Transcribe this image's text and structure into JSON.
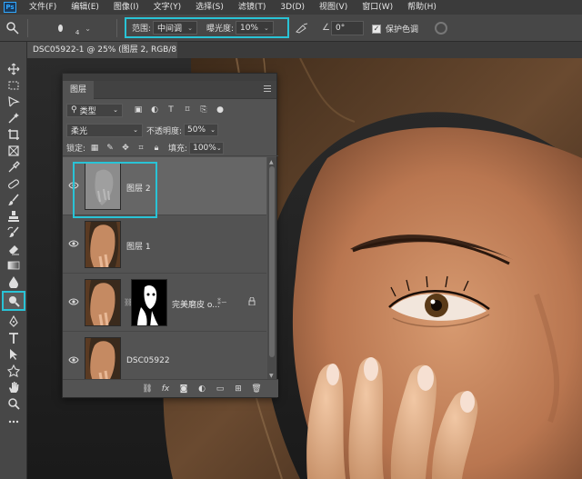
{
  "menubar": {
    "items": [
      "文件(F)",
      "编辑(E)",
      "图像(I)",
      "文字(Y)",
      "选择(S)",
      "滤镜(T)",
      "3D(D)",
      "视图(V)",
      "窗口(W)",
      "帮助(H)"
    ]
  },
  "options": {
    "brush_size": "4",
    "range_label": "范围:",
    "range_value": "中间调",
    "exposure_label": "曝光度:",
    "exposure_value": "10%",
    "angle_value": "0°",
    "protect_tones_label": "保护色调",
    "protect_tones_checked": true
  },
  "document": {
    "tab_title": "DSC05922-1 @ 25% (图层 2, RGB/8) *",
    "close": "×"
  },
  "layers_panel": {
    "tab": "图层",
    "filter_kind": "类型",
    "blend_mode": "柔光",
    "opacity_label": "不透明度:",
    "opacity_value": "50%",
    "lock_label": "锁定:",
    "fill_label": "填充:",
    "fill_value": "100%",
    "layers": [
      {
        "name": "图层 2",
        "selected": true,
        "visible": true
      },
      {
        "name": "图层 1",
        "selected": false,
        "visible": true
      },
      {
        "name": "完美磨皮 o...",
        "selected": false,
        "visible": true,
        "has_mask": true,
        "locked": true
      },
      {
        "name": "DSC05922",
        "selected": false,
        "visible": true
      }
    ]
  },
  "colors": {
    "highlight": "#29c3d6",
    "panel_bg": "#535353",
    "selected_layer": "#666666"
  }
}
